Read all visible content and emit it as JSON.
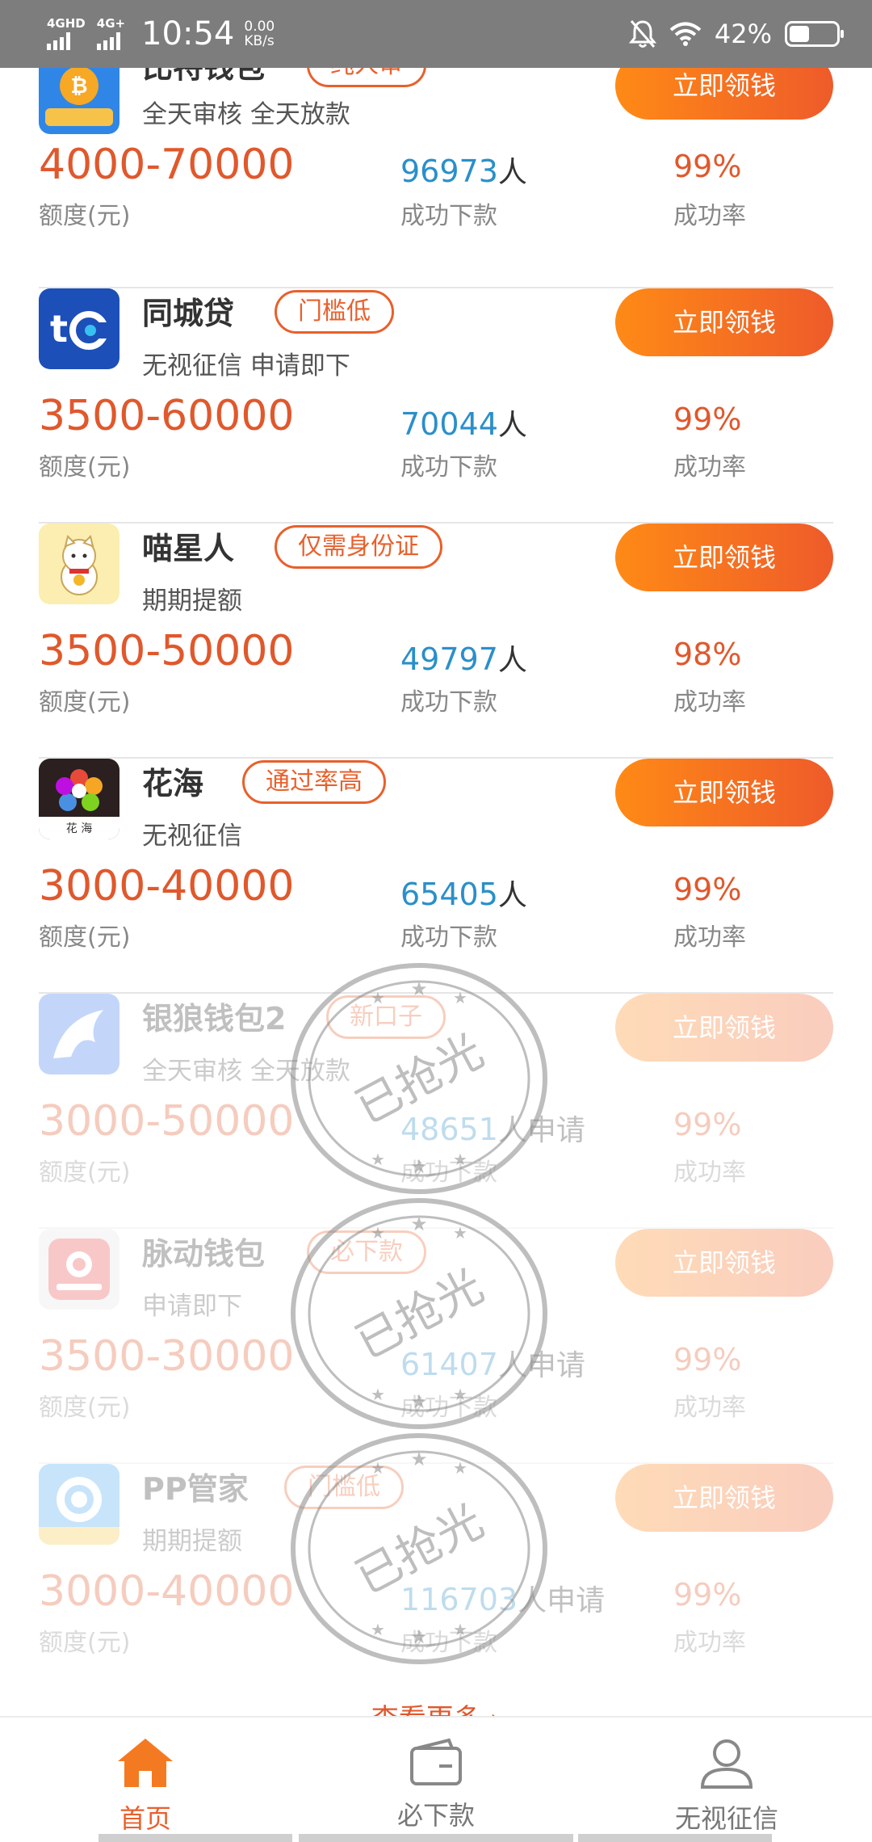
{
  "status_bar": {
    "sim1": "4GHD",
    "sim2": "4G+",
    "time": "10:54",
    "speed_value": "0.00",
    "speed_unit": "KB/s",
    "battery_percent": "42%",
    "battery_level": 0.42
  },
  "labels": {
    "amount_unit": "额度(元)",
    "count_unit": "成功下款",
    "rate_unit": "成功率",
    "person": "人",
    "person_apply": "人申请",
    "claim_button": "立即领钱",
    "stamp_text": "已抢光"
  },
  "products": [
    {
      "name": "比特钱包",
      "tag": "纯人审",
      "desc": "全天审核 全天放款",
      "amount": "4000-70000",
      "count": "96973",
      "rate": "99%",
      "logo": "bitcoin-wallet-logo",
      "sold_out": false
    },
    {
      "name": "同城贷",
      "tag": "门槛低",
      "desc": "无视征信 申请即下",
      "amount": "3500-60000",
      "count": "70044",
      "rate": "99%",
      "logo": "tc-logo",
      "sold_out": false
    },
    {
      "name": "喵星人",
      "tag": "仅需身份证",
      "desc": "期期提额",
      "amount": "3500-50000",
      "count": "49797",
      "rate": "98%",
      "logo": "lucky-cat-logo",
      "sold_out": false
    },
    {
      "name": "花海",
      "tag": "通过率高",
      "desc": "无视征信",
      "amount": "3000-40000",
      "count": "65405",
      "rate": "99%",
      "logo": "flower-logo",
      "logo_caption": "花 海",
      "sold_out": false
    },
    {
      "name": "银狼钱包2",
      "tag": "新口子",
      "desc": "全天审核 全天放款",
      "amount": "3000-50000",
      "count": "48651",
      "rate": "99%",
      "logo": "wolf-logo",
      "sold_out": true
    },
    {
      "name": "脉动钱包",
      "tag": "必下款",
      "desc": "申请即下",
      "amount": "3500-30000",
      "count": "61407",
      "rate": "99%",
      "logo": "pulse-wallet-logo",
      "sold_out": true
    },
    {
      "name": "PP管家",
      "tag": "门槛低",
      "desc": "期期提额",
      "amount": "3000-40000",
      "count": "116703",
      "rate": "99%",
      "logo": "pp-logo",
      "sold_out": true
    }
  ],
  "more_link": "查看更多 ›",
  "tabs": [
    {
      "label": "首页",
      "icon": "home-icon",
      "active": true
    },
    {
      "label": "必下款",
      "icon": "wallet-icon",
      "active": false
    },
    {
      "label": "无视征信",
      "icon": "user-icon",
      "active": false
    }
  ],
  "colors": {
    "accent": "#e8602c",
    "button_start": "#ff8a16",
    "button_end": "#ee5b2a",
    "count_blue": "#2a8fca",
    "status_bar": "#7d7d7d"
  }
}
